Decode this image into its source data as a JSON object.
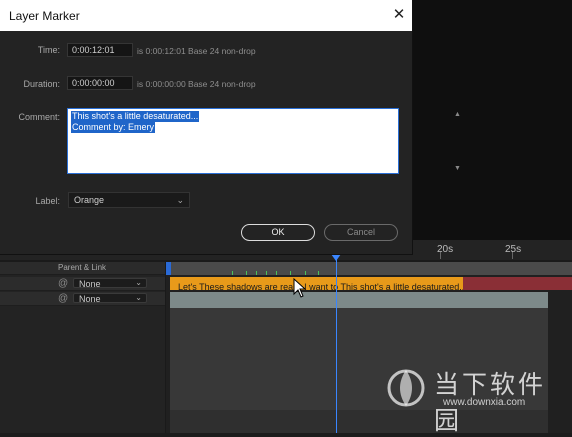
{
  "dialog": {
    "title": "Layer Marker",
    "time_label": "Time:",
    "time_value": "0:00:12:01",
    "time_info": "is 0:00:12:01  Base 24  non-drop",
    "duration_label": "Duration:",
    "duration_value": "0:00:00:00",
    "duration_info": "is 0:00:00:00  Base 24  non-drop",
    "comment_label": "Comment:",
    "comment_lines": [
      "This shot's a little desaturated...",
      "Comment by: Emery"
    ],
    "label_label": "Label:",
    "label_value": "Orange",
    "ok_label": "OK",
    "cancel_label": "Cancel"
  },
  "timeline": {
    "ruler_labels": [
      "20s",
      "25s"
    ],
    "header_parent_link": "Parent & Link",
    "layers": [
      {
        "parent": "None"
      },
      {
        "parent": "None"
      }
    ],
    "marker_text": "Let's  These shadows are really  I want to  This shot's a little desaturated..."
  },
  "watermark": {
    "text_cn": "当下软件园",
    "url": "www.downxia.com"
  },
  "colors": {
    "marker_orange": "#e89a1a",
    "selection_blue": "#1f65c9",
    "playhead_blue": "#3a86ff",
    "track_red": "#8a2f36"
  }
}
